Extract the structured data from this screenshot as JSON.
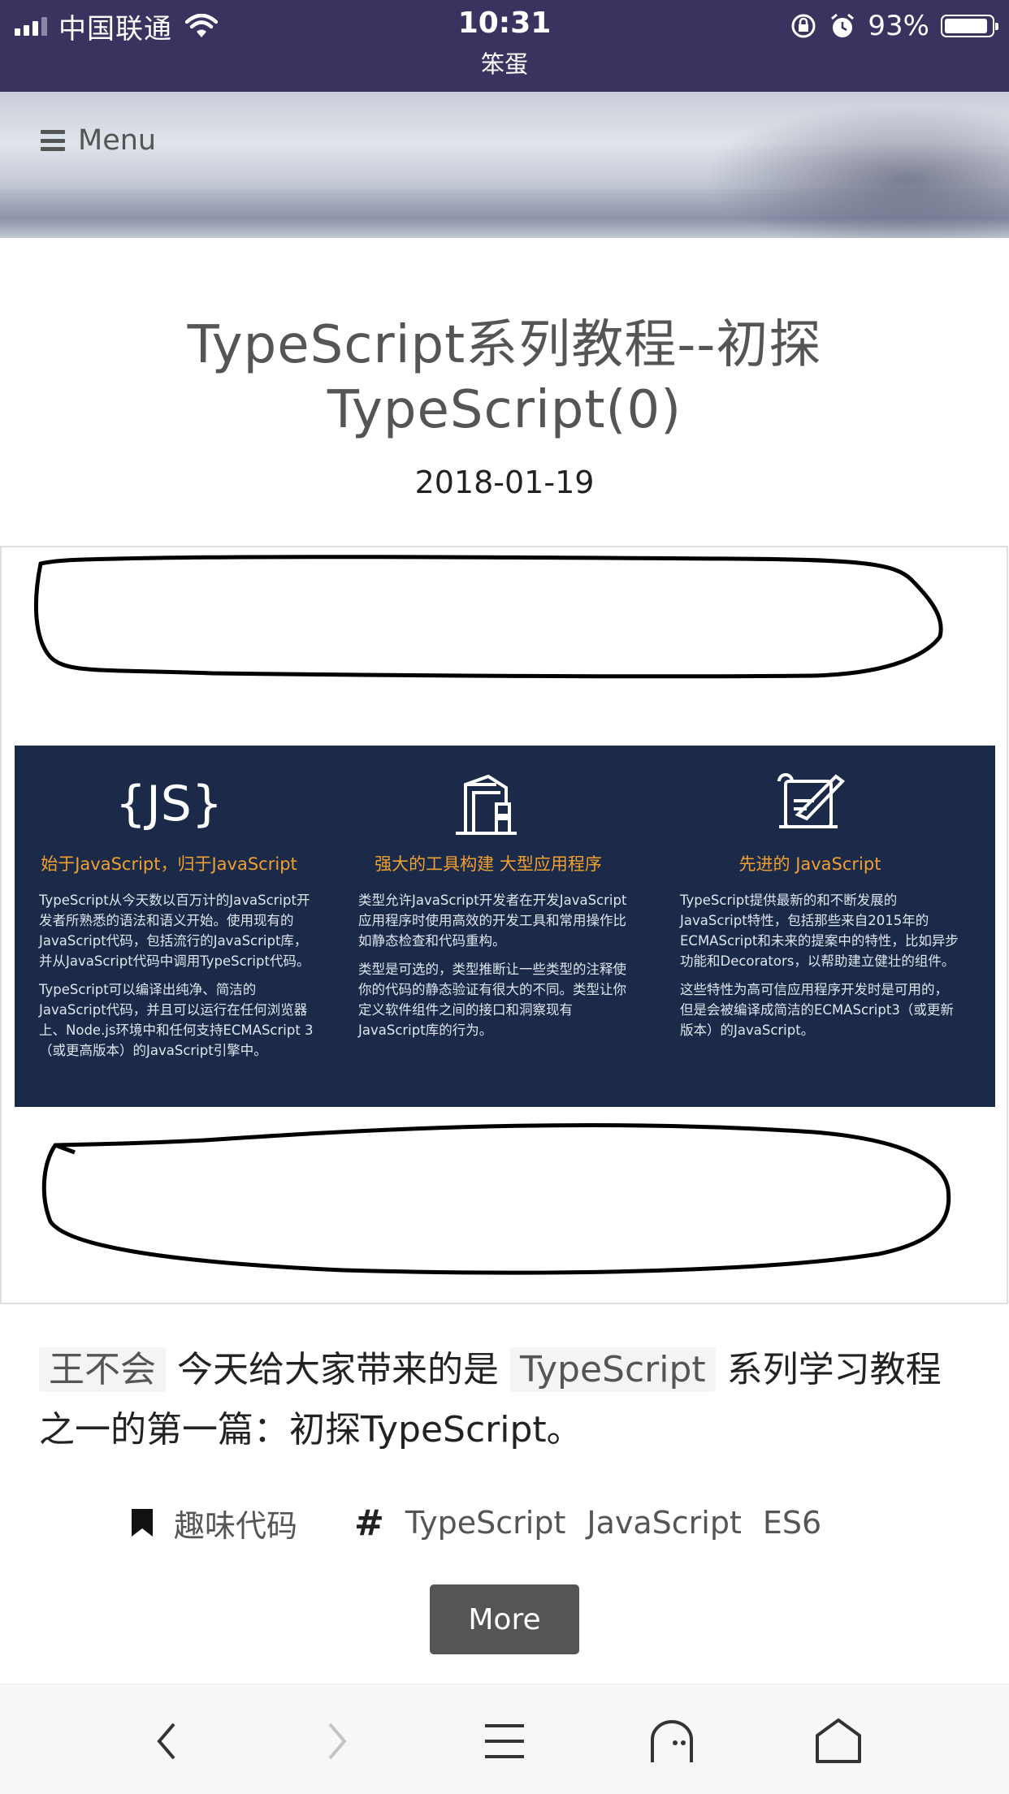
{
  "status_bar": {
    "carrier": "中国联通",
    "time": "10:31",
    "app_subtitle": "笨蛋",
    "battery_percent": "93%",
    "battery_level": 0.93
  },
  "header": {
    "menu_label": "Menu"
  },
  "article": {
    "title": "TypeScript系列教程--初探TypeScript(0)",
    "date": "2018-01-19",
    "image": {
      "columns": [
        {
          "icon": "js-braces-icon",
          "heading": "始于JavaScript，归于JavaScript",
          "paragraphs": [
            "TypeScript从今天数以百万计的JavaScript开发者所熟悉的语法和语义开始。使用现有的JavaScript代码，包括流行的JavaScript库，并从JavaScript代码中调用TypeScript代码。",
            "TypeScript可以编译出纯净、简洁的JavaScript代码，并且可以运行在任何浏览器上、Node.js环境中和任何支持ECMAScript 3（或更高版本）的JavaScript引擎中。"
          ]
        },
        {
          "icon": "crane-icon",
          "heading": "强大的工具构建 大型应用程序",
          "paragraphs": [
            "类型允许JavaScript开发者在开发JavaScript应用程序时使用高效的开发工具和常用操作比如静态检查和代码重构。",
            "类型是可选的，类型推断让一些类型的注释使你的代码的静态验证有很大的不同。类型让你定义软件组件之间的接口和洞察现有JavaScript库的行为。"
          ]
        },
        {
          "icon": "scroll-quill-icon",
          "heading": "先进的 JavaScript",
          "paragraphs": [
            "TypeScript提供最新的和不断发展的JavaScript特性，包括那些来自2015年的ECMAScript和未来的提案中的特性，比如异步功能和Decorators，以帮助建立健壮的组件。",
            "这些特性为高可信应用程序开发时是可用的，但是会被编译成简洁的ECMAScript3（或更新版本）的JavaScript。"
          ]
        }
      ]
    },
    "lead": {
      "author": "王不会",
      "part1": " 今天给大家带来的是 ",
      "code_term": "TypeScript",
      "part2": " 系列学习教程之一的第一篇：初探TypeScript。"
    },
    "category": "趣味代码",
    "tags": [
      "TypeScript",
      "JavaScript",
      "ES6"
    ],
    "more_label": "More"
  },
  "toolbar": {
    "icons": [
      "back-icon",
      "forward-icon",
      "menu-icon",
      "ghost-icon",
      "home-icon"
    ]
  },
  "colors": {
    "status_bar_bg": "#3a3360",
    "banner_bg": "#1b2a48",
    "banner_heading": "#f0a030",
    "button_bg": "#555555"
  }
}
